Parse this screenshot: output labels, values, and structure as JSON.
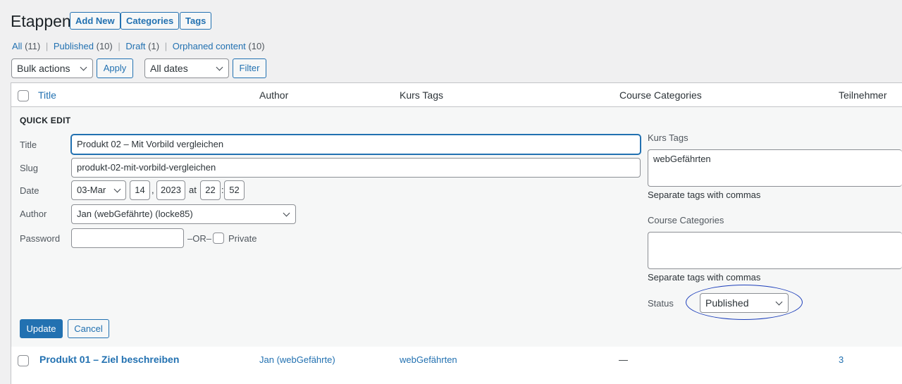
{
  "page": {
    "title": "Etappen",
    "add_new": "Add New",
    "categories": "Categories",
    "tags": "Tags"
  },
  "views": [
    {
      "label": "All",
      "count": "(11)"
    },
    {
      "label": "Published",
      "count": "(10)"
    },
    {
      "label": "Draft",
      "count": "(1)"
    },
    {
      "label": "Orphaned content",
      "count": "(10)"
    }
  ],
  "views_separator": "|",
  "toolbar": {
    "bulk_actions": "Bulk actions",
    "apply": "Apply",
    "dates": "All dates",
    "filter": "Filter"
  },
  "columns": {
    "title": "Title",
    "author": "Author",
    "kurs_tags": "Kurs Tags",
    "course_categories": "Course Categories",
    "teilnehmer": "Teilnehmer"
  },
  "quick_edit": {
    "heading": "QUICK EDIT",
    "title_label": "Title",
    "title_value": "Produkt 02 – Mit Vorbild vergleichen",
    "slug_label": "Slug",
    "slug_value": "produkt-02-mit-vorbild-vergleichen",
    "date_label": "Date",
    "month": "03-Mar",
    "day": "14",
    "comma": ",",
    "year": "2023",
    "at": "at",
    "hour": "22",
    "colon": ":",
    "minute": "52",
    "author_label": "Author",
    "author_value": "Jan (webGefährte) (locke85)",
    "password_label": "Password",
    "password_value": "",
    "or": "–OR–",
    "private_label": "Private",
    "private_checked": false,
    "kurs_tags_label": "Kurs Tags",
    "kurs_tags_value": "webGefährten",
    "kurs_tags_help": "Separate tags with commas",
    "course_categories_label": "Course Categories",
    "course_categories_value": "",
    "course_categories_help": "Separate tags with commas",
    "status_label": "Status",
    "status_value": "Published",
    "update": "Update",
    "cancel": "Cancel"
  },
  "rows": [
    {
      "title": "Produkt 01 – Ziel beschreiben",
      "author": "Jan (webGefährte)",
      "kurs_tags": "webGefährten",
      "course_categories": "—",
      "teilnehmer": "3"
    }
  ],
  "colors": {
    "accent": "#2271b1",
    "background": "#f0f0f1",
    "highlight": "#1d3fbb"
  }
}
